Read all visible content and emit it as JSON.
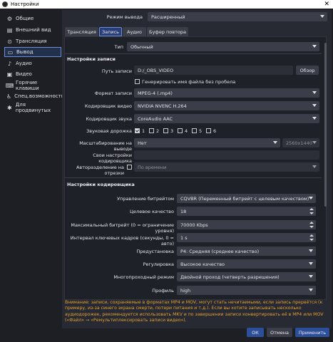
{
  "window": {
    "title": "Настройки",
    "close_glyph": "✕"
  },
  "sidebar": {
    "items": [
      {
        "label": "Общие",
        "icon": "gear-icon",
        "glyph": "⚙"
      },
      {
        "label": "Внешний вид",
        "icon": "appearance-icon",
        "glyph": "▤"
      },
      {
        "label": "Трансляция",
        "icon": "stream-icon",
        "glyph": "⊙"
      },
      {
        "label": "Вывод",
        "icon": "output-icon",
        "glyph": "▭",
        "selected": true
      },
      {
        "label": "Аудио",
        "icon": "audio-icon",
        "glyph": "♪"
      },
      {
        "label": "Видео",
        "icon": "video-icon",
        "glyph": "▣"
      },
      {
        "label": "Горячие клавиши",
        "icon": "keyboard-icon",
        "glyph": "⌨"
      },
      {
        "label": "Спец.возможности",
        "icon": "accessibility-icon",
        "glyph": "♿"
      },
      {
        "label": "Для продвинутых",
        "icon": "advanced-icon",
        "glyph": "✱"
      }
    ]
  },
  "output_mode": {
    "label": "Режим вывода",
    "value": "Расширенный"
  },
  "tabs": [
    {
      "label": "Трансляция"
    },
    {
      "label": "Запись",
      "active": true
    },
    {
      "label": "Аудио"
    },
    {
      "label": "Буфер повтора"
    }
  ],
  "type_row": {
    "label": "Тип",
    "value": "Обычный"
  },
  "recording": {
    "section_title": "Настройки записи",
    "path_label": "Путь записи",
    "path_value": "D:/_OBS_VIDEO",
    "browse_label": "Обзор",
    "no_space_label": "Генерировать имя файла без пробела",
    "format_label": "Формат записи",
    "format_value": "MPEG-4 (.mp4)",
    "video_encoder_label": "Кодировщик видео",
    "video_encoder_value": "NVIDIA NVENC H.264",
    "audio_encoder_label": "Кодировщик звука",
    "audio_encoder_value": "CoreAudio AAC",
    "audio_tracks_label": "Звуковая дорожка",
    "audio_tracks": [
      {
        "label": "1",
        "checked": true
      },
      {
        "label": "2",
        "checked": false
      },
      {
        "label": "3",
        "checked": false
      },
      {
        "label": "4",
        "checked": false
      },
      {
        "label": "5",
        "checked": false
      },
      {
        "label": "6",
        "checked": false
      }
    ],
    "rescale_label": "Масштабирование на выводе",
    "rescale_value": "Нет",
    "rescale_resolution": "2560x1440",
    "custom_encoder_label": "Свои настройки кодировщика",
    "split_label": "Авторазделение на отрезки",
    "split_value": "По времени"
  },
  "encoder": {
    "section_title": "Настройки кодировщика",
    "rate_control_label": "Управление битрейтом",
    "rate_control_value": "CQVBR (Переменный битрейт с целевым качеством)",
    "target_quality_label": "Целевое качество",
    "target_quality_value": "18",
    "max_bitrate_label": "Максимальный битрейт (0 = ограничение уровня)",
    "max_bitrate_value": "70000 Kbps",
    "keyframe_label": "Интервал ключевых кадров (секунды, 0 = авто)",
    "keyframe_value": "1 s",
    "preset_label": "Предустановка",
    "preset_value": "P4: Средняя (среднее качество)",
    "tuning_label": "Регулировка",
    "tuning_value": "Высокое качество",
    "multipass_label": "Многопроходный режим",
    "multipass_value": "Двойной проход (четверть разрешения)",
    "profile_label": "Профиль",
    "profile_value": "high"
  },
  "warning_text": "Внимание: записи, сохраняемые в форматах MP4 и MOV, могут стать нечитаемыми, если запись прервётся (к примеру, из-за синего экрана смерти, потери питания и т.д.). Если вы хотите записывать несколько аудиодорожек, рекомендуется использовать MKV и по завершении записи конвертировать её в MP4 или MOV («Файл» → «Ремультиплексировать записи видео»).",
  "buttons": {
    "ok": "ОК",
    "cancel": "Отмена",
    "apply": "Применить"
  },
  "colors": {
    "accent": "#2c4f9a",
    "warning": "#e4a030",
    "selection_border": "#6a8fd8"
  }
}
